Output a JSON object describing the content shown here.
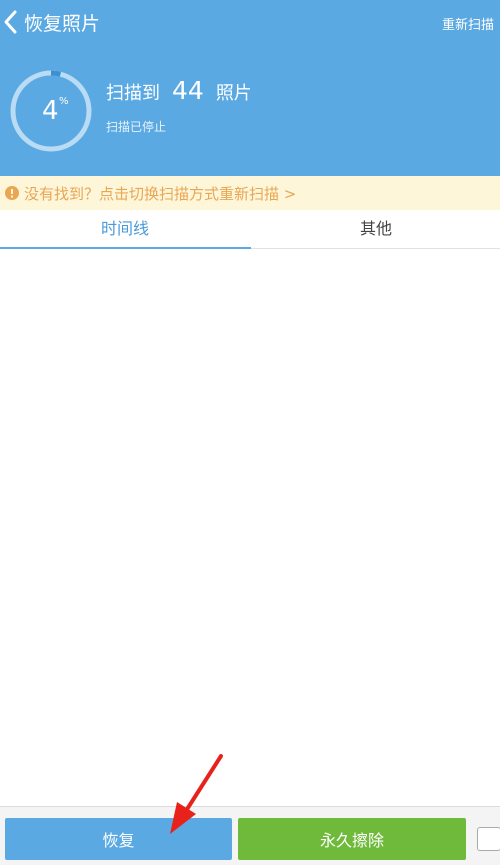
{
  "header": {
    "title": "恢复照片",
    "rescan_label": "重新扫描",
    "progress_percent": 4,
    "progress_value": "4",
    "progress_unit": "%",
    "scan_prefix": "扫描到",
    "scan_count": "44",
    "scan_suffix": "照片",
    "scan_status": "扫描已停止"
  },
  "notice": {
    "text": "没有找到？点击切换扫描方式重新扫描 >"
  },
  "tabs": [
    {
      "label": "时间线",
      "active": true
    },
    {
      "label": "其他",
      "active": false
    }
  ],
  "footer": {
    "restore_label": "恢复",
    "erase_label": "永久擦除"
  },
  "colors": {
    "header_bg": "#5aa9e2",
    "notice_bg": "#fdf6d9",
    "notice_text": "#e9a653",
    "restore_bg": "#5aa9e2",
    "erase_bg": "#6fba3b",
    "arrow": "#e8221b"
  },
  "icons": [
    "chevron-left-icon",
    "info-icon",
    "arrow-annotation-icon"
  ]
}
